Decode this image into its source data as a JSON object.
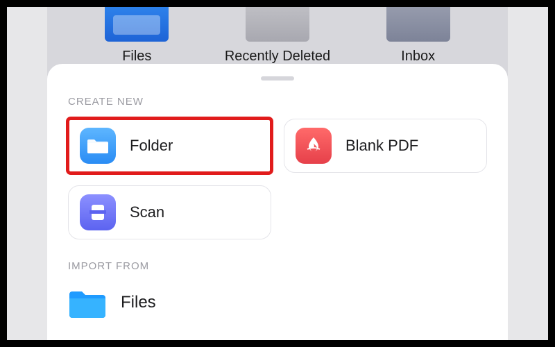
{
  "background": {
    "items": [
      {
        "label": "Files"
      },
      {
        "label": "Recently Deleted"
      },
      {
        "label": "Inbox"
      }
    ]
  },
  "sheet": {
    "create_section_title": "CREATE NEW",
    "create_options": {
      "folder": "Folder",
      "blank_pdf": "Blank PDF",
      "scan": "Scan"
    },
    "import_section_title": "IMPORT FROM",
    "import_options": {
      "files": "Files"
    }
  },
  "highlight": "folder"
}
